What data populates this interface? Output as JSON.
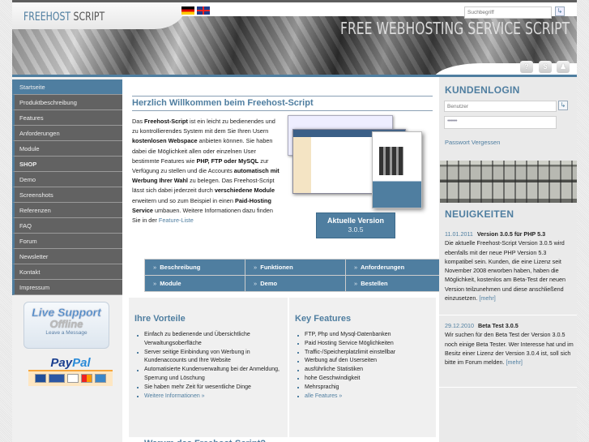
{
  "header": {
    "logo_part1": "FREEHOST",
    "logo_part2": " SCRIPT",
    "slogan": "FREE WEBHOSTING SERVICE SCRIPT",
    "search_placeholder": "Suchbegriff",
    "search_button": "↳",
    "languages": [
      "Deutsch",
      "English"
    ],
    "icons": [
      {
        "name": "help-icon",
        "glyph": "?"
      },
      {
        "name": "dollar-icon",
        "glyph": "$"
      },
      {
        "name": "user-icon",
        "glyph": "♟"
      }
    ]
  },
  "nav": {
    "items": [
      {
        "label": "Startseite",
        "active": true
      },
      {
        "label": "Produktbeschreibung"
      },
      {
        "label": "Features"
      },
      {
        "label": "Anforderungen"
      },
      {
        "label": "Module"
      },
      {
        "label": "SHOP",
        "bold": true
      },
      {
        "label": "Demo"
      },
      {
        "label": "Screenshots"
      },
      {
        "label": "Referenzen"
      },
      {
        "label": "FAQ"
      },
      {
        "label": "Forum"
      },
      {
        "label": "Newsletter"
      },
      {
        "label": "Kontakt"
      },
      {
        "label": "Impressum"
      }
    ]
  },
  "live_support": {
    "line1": "Live Support",
    "line2": "Offline",
    "line3": "Leave a Message"
  },
  "paypal": {
    "label1": "Pay",
    "label2": "Pal",
    "cards": [
      "EC",
      "giropay",
      "VISA",
      "MC",
      "AMEX"
    ]
  },
  "main": {
    "welcome_title": "Herzlich Willkommen beim Freehost-Script",
    "intro": {
      "t1": "Das ",
      "b1": "Freehost-Script",
      "t2": " ist ein leicht zu bedienendes und zu kontrollierendes System mit dem Sie Ihren Usern ",
      "b2": "kostenlosen Webspace",
      "t3": " anbieten können. Sie haben dabei die Möglichkeit allen oder einzelnen User bestimmte Features wie ",
      "b3": "PHP, FTP oder MySQL",
      "t4": " zur Verfügung zu stellen und die Accounts ",
      "b4": "automatisch mit Werbung Ihrer Wahl",
      "t5": " zu belegen. Das Freehost-Script lässt sich dabei jederzeit durch ",
      "b5": "verschiedene Module",
      "t6": " erweitern und so zum Beispiel in einen ",
      "b6": "Paid-Hosting Service",
      "t7": " umbauen. Weitere Informationen dazu finden Sie in der ",
      "link": "Feature-Liste"
    },
    "version_box": {
      "title": "Aktuelle Version",
      "version": "3.0.5"
    },
    "quicknav": [
      "Beschreibung",
      "Funktionen",
      "Anforderungen",
      "Module",
      "Demo",
      "Bestellen"
    ],
    "quicknav_prefix": "»",
    "vorteile": {
      "title": "Ihre Vorteile",
      "items": [
        "Einfach zu bedienende und Übersichtliche Verwaltungsoberfläche",
        "Server seitige Einbindung von Werbung in Kundenaccounts und Ihre Website",
        "Automatisierte Kundenverwaltung bei der Anmeldung, Sperrung und Löschung",
        "Sie haben mehr Zeit für wesentliche Dinge"
      ],
      "link": "Weitere Informationen »"
    },
    "features": {
      "title": "Key Features",
      "items": [
        "FTP, Php und Mysql-Datenbanken",
        "Paid Hosting Service Möglichkeiten",
        "Traffic-/Speicherplatzlimit einstellbar",
        "Werbung auf den Userseiten",
        "ausführliche Statistiken",
        "hohe Geschwindigkeit",
        "Mehrsprachig"
      ],
      "link": "alle Features »"
    },
    "bottom_heading": "Warum das Freehost-Script?"
  },
  "login": {
    "title": "KUNDENLOGIN",
    "user_placeholder": "Benutzer",
    "password_value": "••••••••",
    "submit": "↳",
    "forgot": "Passwort Vergessen"
  },
  "news": {
    "title": "NEUIGKEITEN",
    "items": [
      {
        "date": "11.01.2011",
        "headline": "Version 3.0.5 für PHP 5.3",
        "text": "Die aktuelle Freehost-Script Version 3.0.5 wird ebenfalls mit der neue PHP Version 5.3 kompatibel sein. Kunden, die eine Lizenz seit November 2008 erworben haben, haben die Möglichkeit, kostenlos am Beta-Test der neuen Version teilzunehmen und diese anschließend einzusetzen. ",
        "more": "[mehr]"
      },
      {
        "date": "29.12.2010",
        "headline": "Beta Test 3.0.5",
        "text": "Wir suchen für den Beta Test der Version 3.0.5 noch einige Beta Tester. Wer Interesse hat und im Besitz einer Lizenz der Version 3.0.4 ist, soll sich bitte im Forum melden. ",
        "more": "[mehr]"
      }
    ]
  },
  "colors": {
    "accent": "#4f7ea0",
    "nav_bg": "#626262",
    "panel_bg": "#f0f0f0"
  }
}
